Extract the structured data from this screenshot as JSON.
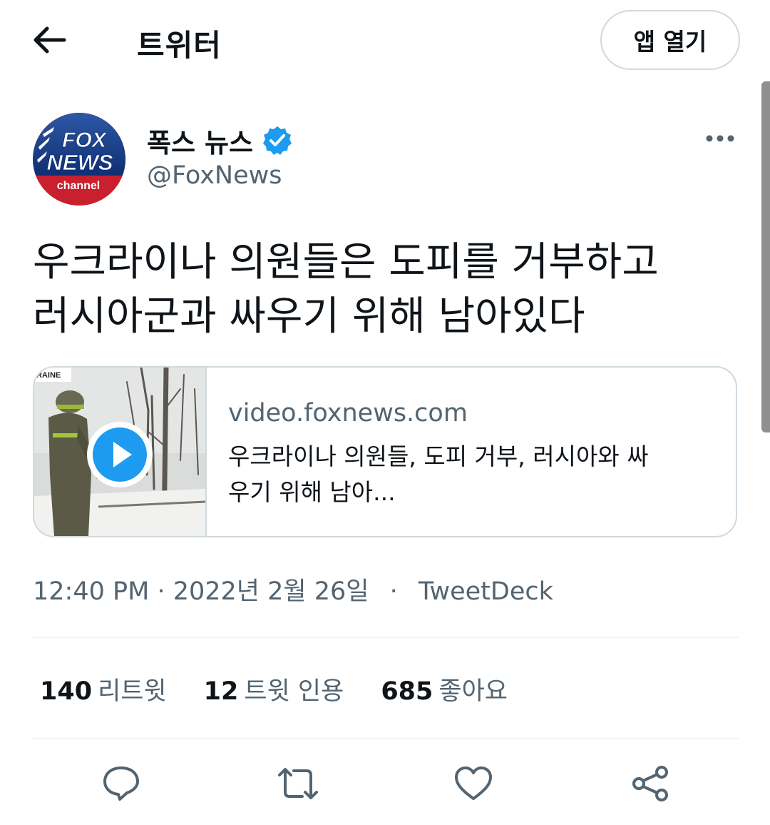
{
  "header": {
    "title": "트위터",
    "open_app_label": "앱 열기",
    "back_icon": "arrow-left-icon"
  },
  "author": {
    "name": "폭스 뉴스",
    "handle": "@FoxNews",
    "verified": true,
    "avatar_text": [
      "FOX",
      "NEWS",
      "channel"
    ]
  },
  "tweet": {
    "line1": "우크라이나 의원들은 도피를 거부하고",
    "line2": "러시아군과 싸우기 위해 남아있다"
  },
  "card": {
    "thumb_caption": "RAINE",
    "domain": "video.foxnews.com",
    "line1": "우크라이나 의원들, 도피 거부, 러시아와 싸",
    "line2": "우기 위해 남아..."
  },
  "meta": {
    "time": "12:40 PM",
    "date": "2022년 2월 26일",
    "separator": "·",
    "source": "TweetDeck"
  },
  "stats": [
    {
      "count": "140",
      "label": "리트윗"
    },
    {
      "count": "12",
      "label": "트윗 인용"
    },
    {
      "count": "685",
      "label": "좋아요"
    }
  ],
  "colors": {
    "text": "#0f1419",
    "secondary": "#536471",
    "border": "#cfd9de",
    "accent": "#1d9bf0"
  }
}
